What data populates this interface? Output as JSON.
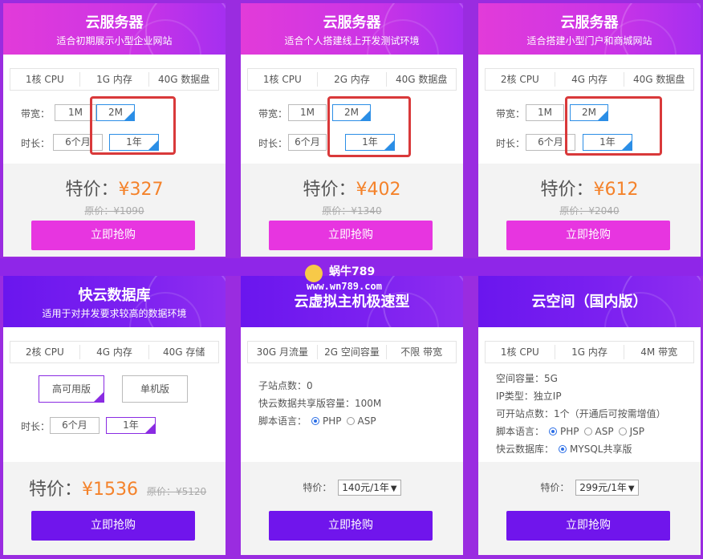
{
  "cards": [
    {
      "title": "云服务器",
      "subtitle": "适合初期展示小型企业网站",
      "specs": [
        "1核 CPU",
        "1G 内存",
        "40G 数据盘"
      ],
      "bandwidth_label": "带宽：",
      "bandwidth_opts": [
        "1M",
        "2M"
      ],
      "duration_label": "时长：",
      "duration_opts": [
        "6个月",
        "1年"
      ],
      "price_label": "特价：",
      "price": "¥327",
      "orig": "原价：¥1090",
      "buy": "立即抢购"
    },
    {
      "title": "云服务器",
      "subtitle": "适合个人搭建线上开发测试环境",
      "specs": [
        "1核 CPU",
        "2G 内存",
        "40G 数据盘"
      ],
      "bandwidth_label": "带宽：",
      "bandwidth_opts": [
        "1M",
        "2M"
      ],
      "duration_label": "时长：",
      "duration_opts": [
        "6个月",
        "1年"
      ],
      "price_label": "特价：",
      "price": "¥402",
      "orig": "原价：¥1340",
      "buy": "立即抢购"
    },
    {
      "title": "云服务器",
      "subtitle": "适合搭建小型门户和商城网站",
      "specs": [
        "2核 CPU",
        "4G 内存",
        "40G 数据盘"
      ],
      "bandwidth_label": "带宽：",
      "bandwidth_opts": [
        "1M",
        "2M"
      ],
      "duration_label": "时长：",
      "duration_opts": [
        "6个月",
        "1年"
      ],
      "price_label": "特价：",
      "price": "¥612",
      "orig": "原价：¥2040",
      "buy": "立即抢购"
    },
    {
      "title": "快云数据库",
      "subtitle": "适用于对并发要求较高的数据环境",
      "specs": [
        "2核 CPU",
        "4G 内存",
        "40G 存储"
      ],
      "mode_opts": [
        "高可用版",
        "单机版"
      ],
      "duration_label": "时长：",
      "duration_opts": [
        "6个月",
        "1年"
      ],
      "price_label": "特价：",
      "price": "¥1536",
      "orig": "原价：¥5120",
      "buy": "立即抢购"
    },
    {
      "title": "云虚拟主机极速型",
      "specs": [
        "30G 月流量",
        "2G 空间容量",
        "不限 带宽"
      ],
      "lines": [
        "子站点数：0",
        "快云数据共享版容量：100M"
      ],
      "script_label": "脚本语言：",
      "script_opts": [
        "PHP",
        "ASP"
      ],
      "price_label": "特价：",
      "select_value": "140元/1年",
      "buy": "立即抢购"
    },
    {
      "title": "云空间（国内版）",
      "specs": [
        "1核 CPU",
        "1G 内存",
        "4M 带宽"
      ],
      "lines": [
        "空间容量：5G",
        "IP类型：独立IP",
        "可开站点数：1个（开通后可按需增值）"
      ],
      "script_label": "脚本语言：",
      "script_opts": [
        "PHP",
        "ASP",
        "JSP"
      ],
      "db_label": "快云数据库：",
      "db_opt": "MYSQL共享版",
      "price_label": "特价：",
      "select_value": "299元/1年",
      "buy": "立即抢购"
    }
  ],
  "watermark": {
    "name": "蜗牛789",
    "url": "www.wn789.com"
  },
  "colors": {
    "accent_orange": "#f4822a",
    "pink": "#e735e0",
    "purple": "#7015ec",
    "highlight_red": "#d9393a"
  }
}
